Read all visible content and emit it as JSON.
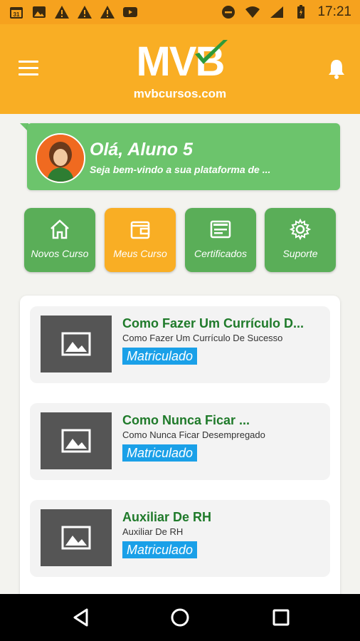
{
  "status_bar": {
    "time": "17:21",
    "calendar_day": "31",
    "icons_left": [
      "calendar-icon",
      "image-icon",
      "warning-icon",
      "warning-icon",
      "warning-icon",
      "youtube-icon"
    ],
    "icons_right": [
      "do-not-disturb-icon",
      "wifi-icon",
      "signal-icon",
      "battery-icon"
    ]
  },
  "header": {
    "logo_text": "MVB",
    "logo_subtitle": "mvbcursos.com",
    "accent_color": "#f9ae24"
  },
  "greeting": {
    "title": "Olá, Aluno 5",
    "subtitle": "Seja bem-vindo a sua plataforma de ..."
  },
  "quick_actions": [
    {
      "label": "Novos Curso",
      "icon": "home-icon",
      "active": false
    },
    {
      "label": "Meus Curso",
      "icon": "wallet-icon",
      "active": true
    },
    {
      "label": "Certificados",
      "icon": "certificate-icon",
      "active": false
    },
    {
      "label": "Suporte",
      "icon": "gear-icon",
      "active": false
    }
  ],
  "courses": [
    {
      "title": "Como Fazer Um Currículo D...",
      "subtitle": "Como Fazer Um Currículo De Sucesso",
      "badge": "Matriculado"
    },
    {
      "title": "Como Nunca Ficar ...",
      "subtitle": "Como Nunca Ficar Desempregado",
      "badge": "Matriculado"
    },
    {
      "title": "Auxiliar De RH",
      "subtitle": "Auxiliar De RH",
      "badge": "Matriculado"
    }
  ],
  "colors": {
    "green": "#5aae58",
    "greeting_green": "#6cc46c",
    "course_title": "#1f7a2a",
    "badge_blue": "#1aa0e8"
  }
}
